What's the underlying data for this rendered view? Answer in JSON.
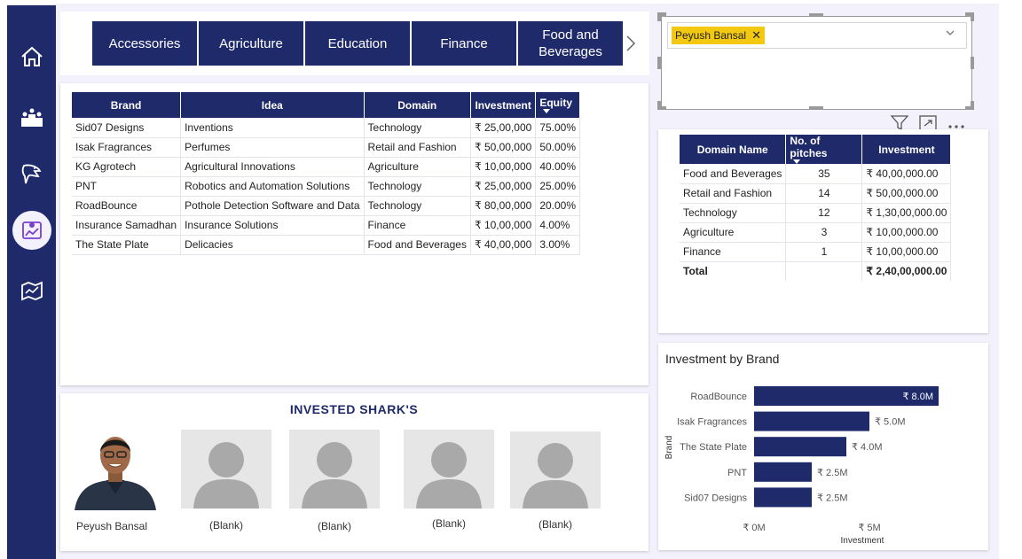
{
  "sidebar": {
    "items": [
      {
        "icon": "home-icon"
      },
      {
        "icon": "ranking-icon"
      },
      {
        "icon": "shark-icon"
      },
      {
        "icon": "analytics-icon",
        "active": true
      },
      {
        "icon": "map-icon"
      }
    ]
  },
  "tiles": [
    {
      "label": "Accessories"
    },
    {
      "label": "Agriculture"
    },
    {
      "label": "Education"
    },
    {
      "label": "Finance"
    },
    {
      "label": "Food and Beverages"
    }
  ],
  "deals_table": {
    "headers": [
      "Brand",
      "Idea",
      "Domain",
      "Investment",
      "Equity"
    ],
    "rows": [
      [
        "Sid07 Designs",
        "Inventions",
        "Technology",
        "₹ 25,00,000",
        "75.00%"
      ],
      [
        "Isak Fragrances",
        "Perfumes",
        "Retail and Fashion",
        "₹ 50,00,000",
        "50.00%"
      ],
      [
        "KG Agrotech",
        "Agricultural Innovations",
        "Agriculture",
        "₹ 10,00,000",
        "40.00%"
      ],
      [
        "PNT",
        "Robotics and Automation Solutions",
        "Technology",
        "₹ 25,00,000",
        "25.00%"
      ],
      [
        "RoadBounce",
        "Pothole Detection Software and Data",
        "Technology",
        "₹ 80,00,000",
        "20.00%"
      ],
      [
        "Insurance Samadhan",
        "Insurance Solutions",
        "Finance",
        "₹ 10,00,000",
        "4.00%"
      ],
      [
        "The State Plate",
        "Delicacies",
        "Food and Beverages",
        "₹ 40,00,000",
        "3.00%"
      ]
    ]
  },
  "filter": {
    "selected": "Peyush Bansal"
  },
  "domain_table": {
    "headers": [
      "Domain Name",
      "No. of pitches",
      "Investment"
    ],
    "rows": [
      [
        "Food and Beverages",
        "35",
        "₹ 40,00,000.00"
      ],
      [
        "Retail and Fashion",
        "14",
        "₹ 50,00,000.00"
      ],
      [
        "Technology",
        "12",
        "₹ 1,30,00,000.00"
      ],
      [
        "Agriculture",
        "3",
        "₹ 10,00,000.00"
      ],
      [
        "Finance",
        "1",
        "₹ 10,00,000.00"
      ]
    ],
    "total": [
      "Total",
      "",
      "₹ 2,40,00,000.00"
    ]
  },
  "sharks": {
    "title": "INVESTED SHARK'S",
    "names": [
      "Peyush Bansal",
      "(Blank)",
      "(Blank)",
      "(Blank)",
      "(Blank)"
    ]
  },
  "chart_data": {
    "type": "bar",
    "orientation": "horizontal",
    "title": "Investment by Brand",
    "xlabel": "Investment",
    "ylabel": "Brand",
    "categories": [
      "RoadBounce",
      "Isak Fragrances",
      "The State Plate",
      "PNT",
      "Sid07 Designs"
    ],
    "values": [
      8.0,
      5.0,
      4.0,
      2.5,
      2.5
    ],
    "value_labels": [
      "₹ 8.0M",
      "₹ 5.0M",
      "₹ 4.0M",
      "₹ 2.5M",
      "₹ 2.5M"
    ],
    "x_ticks": [
      "₹ 0M",
      "₹ 5M"
    ],
    "xlim": [
      0,
      8.0
    ],
    "color": "#1f2a6b"
  }
}
